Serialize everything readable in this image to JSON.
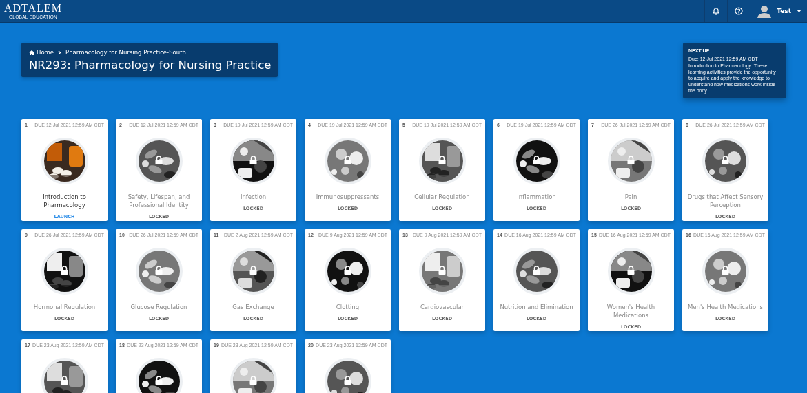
{
  "topbar": {
    "logo": "ADTALEM",
    "tagline": "GLOBAL EDUCATION",
    "user": "Test"
  },
  "header": {
    "breadcrumb": [
      {
        "label": "Home",
        "kind": "home"
      },
      {
        "label": "Pharmacology for Nursing Practice-South",
        "kind": "link"
      }
    ],
    "title": "NR293: Pharmacology for Nursing Practice"
  },
  "next_up": {
    "heading": "NEXT UP",
    "due": "Due: 12 Jul 2021 12:59 AM CDT",
    "description": "Introduction to Pharmacology: These learning activities provide the opportunity to acquire and apply the knowledge to understand how medications work inside the body."
  },
  "modules": [
    {
      "number": "1",
      "due": "DUE 12 Jul 2021 12:59 AM CDT",
      "title": "Introduction to Pharmacology",
      "action": "LAUNCH",
      "locked": false
    },
    {
      "number": "2",
      "due": "DUE 12 Jul 2021 12:59 AM CDT",
      "title": "Safety, Lifespan, and Professional Identity",
      "action": "LOCKED",
      "locked": true
    },
    {
      "number": "3",
      "due": "DUE 19 Jul 2021 12:59 AM CDT",
      "title": "Infection",
      "action": "LOCKED",
      "locked": true
    },
    {
      "number": "4",
      "due": "DUE 19 Jul 2021 12:59 AM CDT",
      "title": "Immunosuppressants",
      "action": "LOCKED",
      "locked": true
    },
    {
      "number": "5",
      "due": "DUE 19 Jul 2021 12:59 AM CDT",
      "title": "Cellular Regulation",
      "action": "LOCKED",
      "locked": true
    },
    {
      "number": "6",
      "due": "DUE 19 Jul 2021 12:59 AM CDT",
      "title": "Inflammation",
      "action": "LOCKED",
      "locked": true
    },
    {
      "number": "7",
      "due": "DUE 26 Jul 2021 12:59 AM CDT",
      "title": "Pain",
      "action": "LOCKED",
      "locked": true
    },
    {
      "number": "8",
      "due": "DUE 26 Jul 2021 12:59 AM CDT",
      "title": "Drugs that Affect Sensory Perception",
      "action": "LOCKED",
      "locked": true
    },
    {
      "number": "9",
      "due": "DUE 26 Jul 2021 12:59 AM CDT",
      "title": "Hormonal Regulation",
      "action": "LOCKED",
      "locked": true
    },
    {
      "number": "10",
      "due": "DUE 26 Jul 2021 12:59 AM CDT",
      "title": "Glucose Regulation",
      "action": "LOCKED",
      "locked": true
    },
    {
      "number": "11",
      "due": "DUE 2 Aug 2021 12:59 AM CDT",
      "title": "Gas Exchange",
      "action": "LOCKED",
      "locked": true
    },
    {
      "number": "12",
      "due": "DUE 9 Aug 2021 12:59 AM CDT",
      "title": "Clotting",
      "action": "LOCKED",
      "locked": true
    },
    {
      "number": "13",
      "due": "DUE 9 Aug 2021 12:59 AM CDT",
      "title": "Cardiovascular",
      "action": "LOCKED",
      "locked": true
    },
    {
      "number": "14",
      "due": "DUE 16 Aug 2021 12:59 AM CDT",
      "title": "Nutrition and Elimination",
      "action": "LOCKED",
      "locked": true
    },
    {
      "number": "15",
      "due": "DUE 16 Aug 2021 12:59 AM CDT",
      "title": "Women's Health Medications",
      "action": "LOCKED",
      "locked": true
    },
    {
      "number": "16",
      "due": "DUE 16 Aug 2021 12:59 AM CDT",
      "title": "Men's Health Medications",
      "action": "LOCKED",
      "locked": true
    },
    {
      "number": "17",
      "due": "DUE 23 Aug 2021 12:59 AM CDT",
      "locked": true
    },
    {
      "number": "18",
      "due": "DUE 23 Aug 2021 12:59 AM CDT",
      "locked": true
    },
    {
      "number": "19",
      "due": "DUE 23 Aug 2021 12:59 AM CDT",
      "locked": true
    },
    {
      "number": "20",
      "due": "DUE 23 Aug 2021 12:59 AM CDT",
      "locked": true
    }
  ]
}
